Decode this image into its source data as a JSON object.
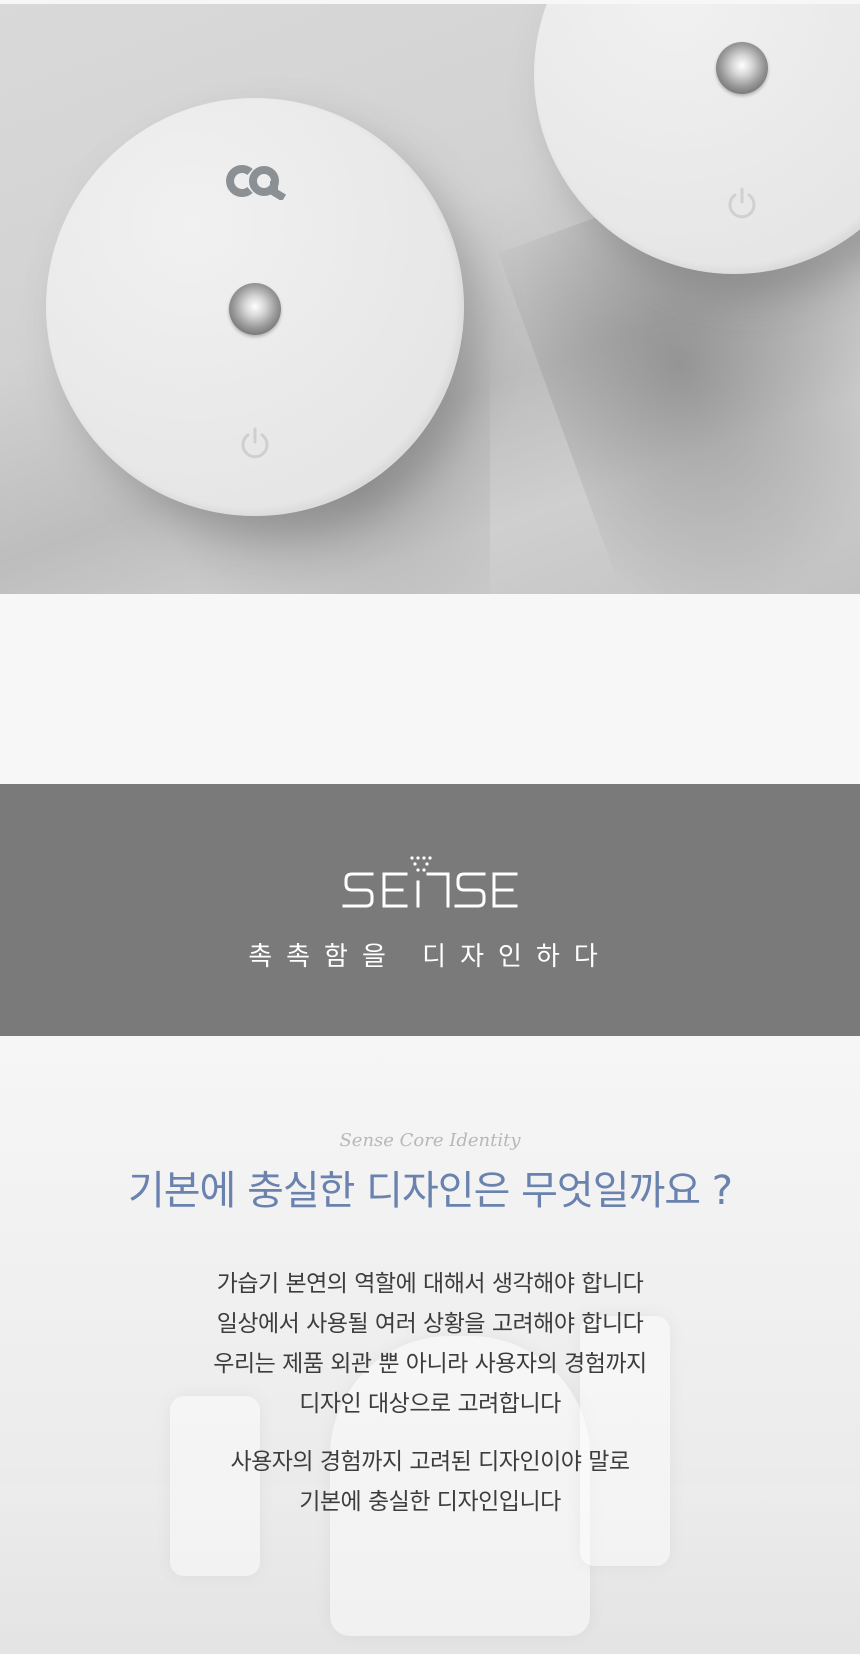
{
  "colors": {
    "banner_bg": "#7a7a7a",
    "headline": "#6a82ae",
    "subtitle": "#b8b8b8",
    "body_text": "#3d3d3d"
  },
  "hero": {
    "icons": [
      "brand-logo-icon",
      "knob-icon",
      "power-icon"
    ]
  },
  "banner": {
    "wordmark": "SENSE",
    "tagline": "촉촉함을 디자인하다"
  },
  "identity": {
    "subtitle": "Sense Core Identity",
    "headline": "기본에 충실한 디자인은 무엇일까요 ?",
    "paragraph1": [
      "가습기 본연의 역할에 대해서 생각해야 합니다",
      "일상에서 사용될 여러 상황을 고려해야 합니다",
      "우리는 제품 외관 뿐 아니라 사용자의 경험까지",
      "디자인 대상으로 고려합니다"
    ],
    "paragraph2": [
      "사용자의 경험까지 고려된 디자인이야 말로",
      "기본에 충실한 디자인입니다"
    ]
  }
}
